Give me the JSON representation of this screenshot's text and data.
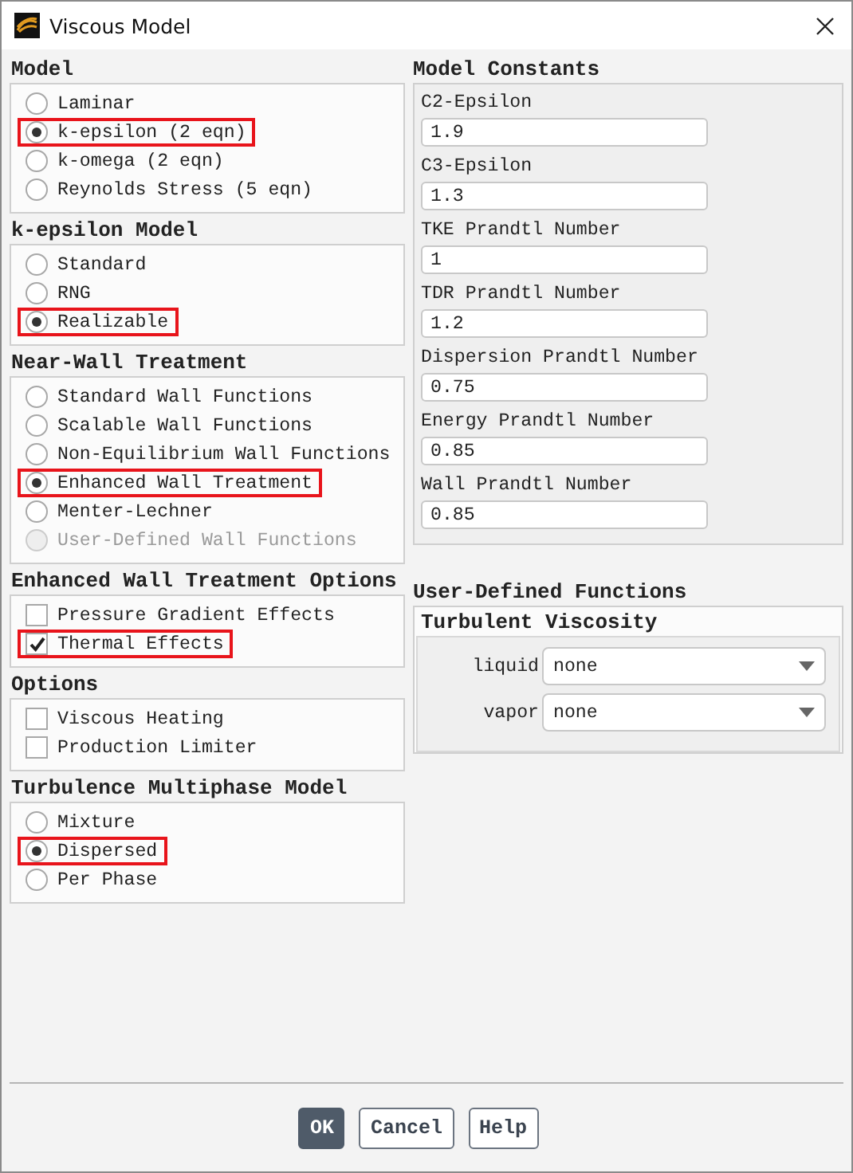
{
  "window": {
    "title": "Viscous Model"
  },
  "left_groups": [
    {
      "title": "Model",
      "items": [
        {
          "kind": "radio",
          "label": "Laminar",
          "selected": false,
          "disabled": false,
          "highlighted": false
        },
        {
          "kind": "radio",
          "label": "k-epsilon (2 eqn)",
          "selected": true,
          "disabled": false,
          "highlighted": true
        },
        {
          "kind": "radio",
          "label": "k-omega (2 eqn)",
          "selected": false,
          "disabled": false,
          "highlighted": false
        },
        {
          "kind": "radio",
          "label": "Reynolds Stress (5 eqn)",
          "selected": false,
          "disabled": false,
          "highlighted": false
        }
      ]
    },
    {
      "title": "k-epsilon Model",
      "items": [
        {
          "kind": "radio",
          "label": "Standard",
          "selected": false,
          "disabled": false,
          "highlighted": false
        },
        {
          "kind": "radio",
          "label": "RNG",
          "selected": false,
          "disabled": false,
          "highlighted": false
        },
        {
          "kind": "radio",
          "label": "Realizable",
          "selected": true,
          "disabled": false,
          "highlighted": true
        }
      ]
    },
    {
      "title": "Near-Wall Treatment",
      "items": [
        {
          "kind": "radio",
          "label": "Standard Wall Functions",
          "selected": false,
          "disabled": false,
          "highlighted": false
        },
        {
          "kind": "radio",
          "label": "Scalable Wall Functions",
          "selected": false,
          "disabled": false,
          "highlighted": false
        },
        {
          "kind": "radio",
          "label": "Non-Equilibrium Wall Functions",
          "selected": false,
          "disabled": false,
          "highlighted": false
        },
        {
          "kind": "radio",
          "label": "Enhanced Wall Treatment",
          "selected": true,
          "disabled": false,
          "highlighted": true
        },
        {
          "kind": "radio",
          "label": "Menter-Lechner",
          "selected": false,
          "disabled": false,
          "highlighted": false
        },
        {
          "kind": "radio",
          "label": "User-Defined Wall Functions",
          "selected": false,
          "disabled": true,
          "highlighted": false
        }
      ]
    },
    {
      "title": "Enhanced Wall Treatment Options",
      "items": [
        {
          "kind": "checkbox",
          "label": "Pressure Gradient Effects",
          "checked": false,
          "disabled": false,
          "highlighted": false
        },
        {
          "kind": "checkbox",
          "label": "Thermal Effects",
          "checked": true,
          "disabled": false,
          "highlighted": true
        }
      ]
    },
    {
      "title": "Options",
      "items": [
        {
          "kind": "checkbox",
          "label": "Viscous Heating",
          "checked": false,
          "disabled": false,
          "highlighted": false
        },
        {
          "kind": "checkbox",
          "label": "Production Limiter",
          "checked": false,
          "disabled": false,
          "highlighted": false
        }
      ]
    },
    {
      "title": "Turbulence Multiphase Model",
      "items": [
        {
          "kind": "radio",
          "label": "Mixture",
          "selected": false,
          "disabled": false,
          "highlighted": false
        },
        {
          "kind": "radio",
          "label": "Dispersed",
          "selected": true,
          "disabled": false,
          "highlighted": true
        },
        {
          "kind": "radio",
          "label": "Per Phase",
          "selected": false,
          "disabled": false,
          "highlighted": false
        }
      ]
    }
  ],
  "model_constants": {
    "title": "Model Constants",
    "fields": [
      {
        "label": "C2-Epsilon",
        "value": "1.9"
      },
      {
        "label": "C3-Epsilon",
        "value": "1.3"
      },
      {
        "label": "TKE Prandtl Number",
        "value": "1"
      },
      {
        "label": "TDR Prandtl Number",
        "value": "1.2"
      },
      {
        "label": "Dispersion Prandtl Number",
        "value": "0.75"
      },
      {
        "label": "Energy Prandtl Number",
        "value": "0.85"
      },
      {
        "label": "Wall Prandtl Number",
        "value": "0.85"
      }
    ]
  },
  "user_defined_functions": {
    "title": "User-Defined Functions",
    "group_title": "Turbulent Viscosity",
    "rows": [
      {
        "label": "liquid",
        "value": "none"
      },
      {
        "label": "vapor",
        "value": "none"
      }
    ]
  },
  "buttons": [
    {
      "label": "OK",
      "default": true
    },
    {
      "label": "Cancel",
      "default": false
    },
    {
      "label": "Help",
      "default": false
    }
  ]
}
